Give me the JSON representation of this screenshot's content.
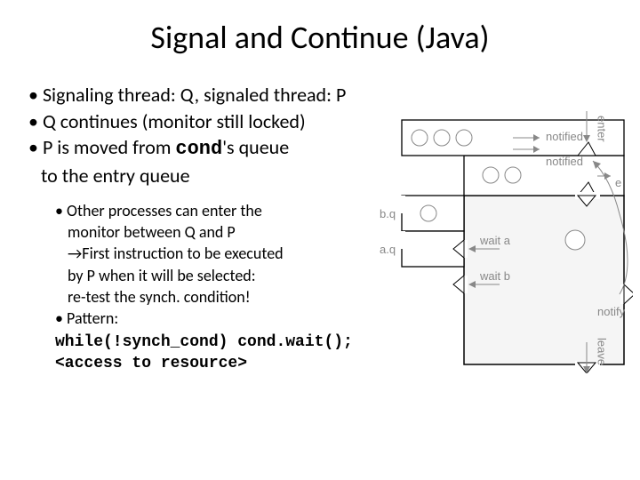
{
  "title": "Signal and Continue (Java)",
  "bullets": {
    "b1": "Signaling thread: Q, signaled thread: P",
    "b2": "Q continues (monitor still locked)",
    "b3a": "P is moved from ",
    "b3code": "cond",
    "b3b": "'s queue",
    "b3c": "to the entry queue",
    "s1a": "Other processes can enter the",
    "s1b": "monitor between Q and P",
    "s1c": "→First instruction to be executed",
    "s1d": "by P when it will be selected:",
    "s1e": "re-test the synch. condition!",
    "s2": "Pattern:",
    "code1": "while(!synch_cond) cond.wait();",
    "code2": "<access to resource>"
  },
  "diagram": {
    "enter": "enter",
    "notified1": "notified",
    "notified2": "notified",
    "e": "e",
    "bq": "b.q",
    "aq": "a.q",
    "waita": "wait a",
    "waitb": "wait b",
    "notify": "notify",
    "leave": "leave"
  }
}
